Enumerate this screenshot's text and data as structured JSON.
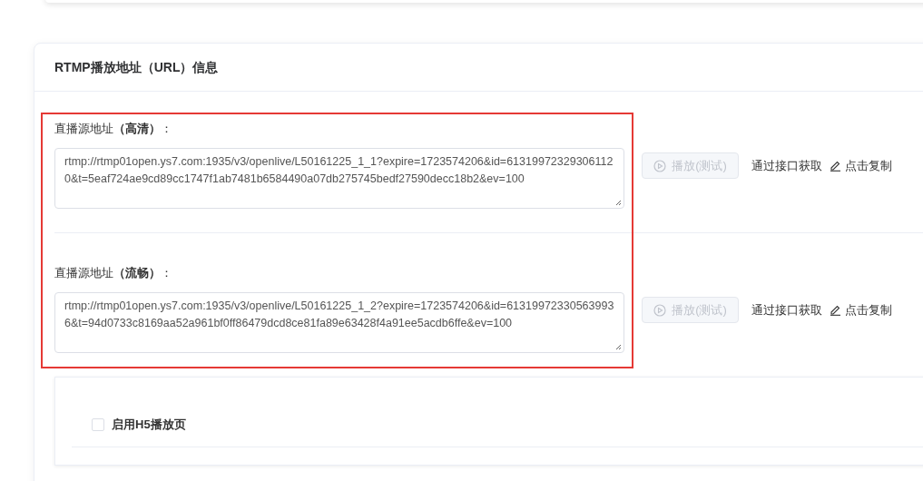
{
  "card": {
    "title": "RTMP播放地址（URL）信息"
  },
  "streams": [
    {
      "label": "直播源地址**（高清）**：",
      "url": "rtmp://rtmp01open.ys7.com:1935/v3/openlive/L50161225_1_1?expire=1723574206&id=613199723293061120&t=5eaf724ae9cd89cc1747f1ab7481b6584490a07db275745bedf27590decc18b2&ev=100",
      "play_button": {
        "label": "播放(测试)",
        "disabled": true
      },
      "fetch_link": "通过接口获取",
      "copy_link": "点击复制"
    },
    {
      "label": "直播源地址**（流畅）**：",
      "url": "rtmp://rtmp01open.ys7.com:1935/v3/openlive/L50161225_1_2?expire=1723574206&id=613199723305639936&t=94d0733c8169aa52a961bf0ff86479dcd8ce81fa89e63428f4a91ee5acdb6ffe&ev=100",
      "play_button": {
        "label": "播放(测试)",
        "disabled": true
      },
      "fetch_link": "通过接口获取",
      "copy_link": "点击复制"
    }
  ],
  "h5": {
    "label": "启用H5播放页",
    "checked": false
  }
}
